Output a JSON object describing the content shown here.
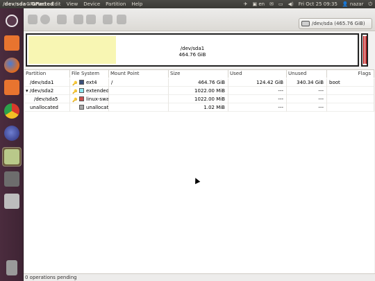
{
  "window": {
    "title": "/dev/sda - GParted"
  },
  "menubar": [
    "GParted",
    "Edit",
    "View",
    "Device",
    "Partition",
    "Help"
  ],
  "tray": {
    "keyboard": "en",
    "clock": "Fri Oct 25 09:35",
    "user": "nazar"
  },
  "device": {
    "label": "/dev/sda  (465.76 GiB)"
  },
  "disk_map": {
    "partition": "/dev/sda1",
    "size": "464.76 GiB"
  },
  "table": {
    "headers": [
      "Partition",
      "File System",
      "Mount Point",
      "Size",
      "Used",
      "Unused",
      "Flags"
    ],
    "rows": [
      {
        "partition": "/dev/sda1",
        "fs": "ext4",
        "fs_color": "#3a4f7a",
        "mount": "/",
        "size": "464.76 GiB",
        "used": "124.42 GiB",
        "unused": "340.34 GiB",
        "flags": "boot"
      },
      {
        "partition": "/dev/sda2",
        "fs": "extended",
        "fs_color": "#8ee8f2",
        "mount": "",
        "size": "1022.00 MiB",
        "used": "---",
        "unused": "---",
        "flags": ""
      },
      {
        "partition": "/dev/sda5",
        "fs": "linux-swap",
        "fs_color": "#c85050",
        "mount": "",
        "size": "1022.00 MiB",
        "used": "---",
        "unused": "---",
        "flags": ""
      },
      {
        "partition": "unallocated",
        "fs": "unallocated",
        "fs_color": "#a8a8a8",
        "mount": "",
        "size": "1.02 MiB",
        "used": "---",
        "unused": "---",
        "flags": ""
      }
    ]
  },
  "status": {
    "text": "0 operations pending"
  },
  "colors": {
    "launcher": "#4b2c3e",
    "used_space": "#f8f6b3"
  },
  "launcher_icons": [
    "ubuntu-dash-icon",
    "files-icon",
    "firefox-icon",
    "software-center-icon",
    "chrome-icon",
    "eclipse-icon",
    "gparted-icon",
    "terminal-icon",
    "drive-icon",
    "trash-icon"
  ]
}
